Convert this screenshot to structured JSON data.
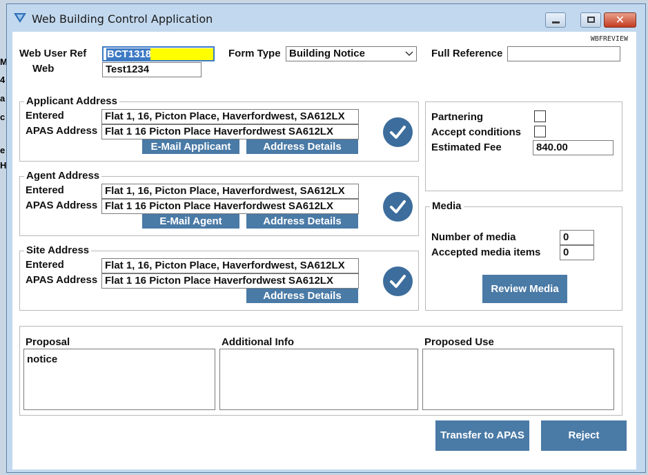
{
  "window": {
    "title": "Web Building Control Application"
  },
  "review_tag": "WBFREVIEW",
  "fields": {
    "web_user_ref_label": "Web User Ref",
    "web_user_ref_value": "BCT1318",
    "web_label": "Web",
    "web_value": "Test1234",
    "form_type_label": "Form Type",
    "form_type_value": "Building Notice",
    "full_reference_label": "Full Reference",
    "full_reference_value": ""
  },
  "applicant": {
    "title": "Applicant Address",
    "entered_label": "Entered",
    "entered_value": "Flat 1, 16, Picton Place, Haverfordwest, SA612LX",
    "apas_label": "APAS Address",
    "apas_value": "Flat 1 16 Picton Place Haverfordwest SA612LX",
    "email_button": "E-Mail Applicant",
    "details_button": "Address Details"
  },
  "agent": {
    "title": "Agent Address",
    "entered_label": "Entered",
    "entered_value": "Flat 1, 16, Picton Place, Haverfordwest, SA612LX",
    "apas_label": "APAS Address",
    "apas_value": "Flat 1 16 Picton Place Haverfordwest SA612LX",
    "email_button": "E-Mail Agent",
    "details_button": "Address Details"
  },
  "site": {
    "title": "Site Address",
    "entered_label": "Entered",
    "entered_value": "Flat 1, 16, Picton Place, Haverfordwest, SA612LX",
    "apas_label": "APAS Address",
    "apas_value": "Flat 1 16 Picton Place Haverfordwest SA612LX",
    "details_button": "Address Details"
  },
  "options": {
    "partnering_label": "Partnering",
    "partnering_checked": false,
    "accept_label": "Accept conditions",
    "accept_checked": false,
    "fee_label": "Estimated Fee",
    "fee_value": "840.00"
  },
  "media": {
    "title": "Media",
    "count_label": "Number of media",
    "count_value": "0",
    "accepted_label": "Accepted media items",
    "accepted_value": "0",
    "review_button": "Review Media"
  },
  "text_sections": {
    "proposal_label": "Proposal",
    "proposal_value": "notice",
    "additional_label": "Additional Info",
    "additional_value": "",
    "use_label": "Proposed Use",
    "use_value": ""
  },
  "actions": {
    "transfer_button": "Transfer to APAS",
    "reject_button": "Reject"
  },
  "colors": {
    "accent": "#4a7aa6",
    "check_circle": "#3c6d9c",
    "highlight": "#ffff00",
    "window_frame": "#c2d8ee"
  },
  "icons": [
    "app-icon",
    "minimize-icon",
    "maximize-icon",
    "close-icon",
    "chevron-down-icon",
    "check-circle-icon"
  ]
}
